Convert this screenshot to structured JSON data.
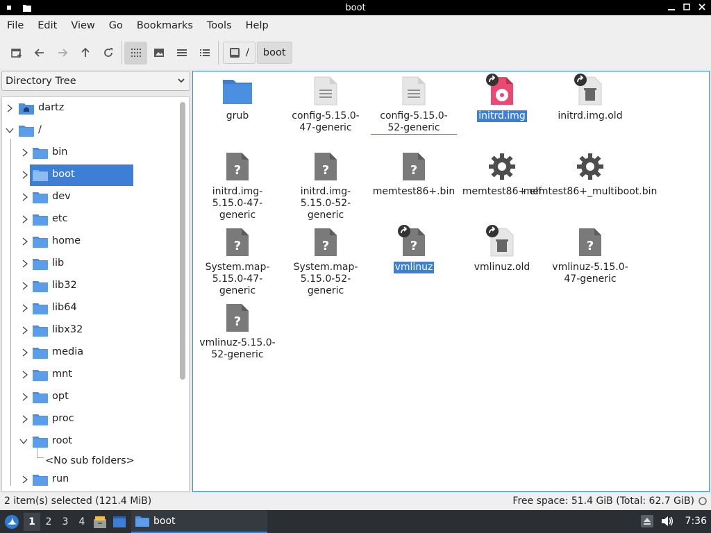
{
  "window": {
    "title": "boot"
  },
  "menu": [
    "File",
    "Edit",
    "View",
    "Go",
    "Bookmarks",
    "Tools",
    "Help"
  ],
  "toolbar": {
    "buttons": [
      "new-tab-icon",
      "back-icon",
      "forward-icon",
      "up-icon",
      "reload-icon",
      "icon-view-icon",
      "thumbnail-view-icon",
      "compact-view-icon",
      "detailed-list-icon"
    ],
    "active_view": "icon-view"
  },
  "path": {
    "root_label": "/",
    "current": "boot"
  },
  "sidebar": {
    "selector_label": "Directory Tree",
    "tree": [
      {
        "label": "dartz",
        "level": 0,
        "expanded": false,
        "icon": "home-folder"
      },
      {
        "label": "/",
        "level": 0,
        "expanded": true,
        "icon": "folder"
      },
      {
        "label": "bin",
        "level": 1,
        "expanded": false
      },
      {
        "label": "boot",
        "level": 1,
        "expanded": false,
        "selected": true
      },
      {
        "label": "dev",
        "level": 1,
        "expanded": false
      },
      {
        "label": "etc",
        "level": 1,
        "expanded": false
      },
      {
        "label": "home",
        "level": 1,
        "expanded": false
      },
      {
        "label": "lib",
        "level": 1,
        "expanded": false
      },
      {
        "label": "lib32",
        "level": 1,
        "expanded": false
      },
      {
        "label": "lib64",
        "level": 1,
        "expanded": false
      },
      {
        "label": "libx32",
        "level": 1,
        "expanded": false
      },
      {
        "label": "media",
        "level": 1,
        "expanded": false
      },
      {
        "label": "mnt",
        "level": 1,
        "expanded": false
      },
      {
        "label": "opt",
        "level": 1,
        "expanded": false
      },
      {
        "label": "proc",
        "level": 1,
        "expanded": false
      },
      {
        "label": "root",
        "level": 1,
        "expanded": true
      },
      {
        "label": "<No sub folders>",
        "level": 2,
        "placeholder": true
      },
      {
        "label": "run",
        "level": 1,
        "expanded": false
      }
    ]
  },
  "files": [
    {
      "name": "grub",
      "type": "folder"
    },
    {
      "name": "config-5.15.0-47-generic",
      "type": "text"
    },
    {
      "name": "config-5.15.0-52-generic",
      "type": "text",
      "focused": true
    },
    {
      "name": "initrd.img",
      "type": "disc",
      "link": true,
      "selected": true
    },
    {
      "name": "initrd.img.old",
      "type": "trash",
      "link": true
    },
    {
      "name": "initrd.img-5.15.0-47-generic",
      "type": "unknown"
    },
    {
      "name": "initrd.img-5.15.0-52-generic",
      "type": "unknown"
    },
    {
      "name": "memtest86+.bin",
      "type": "unknown"
    },
    {
      "name": "memtest86+.elf",
      "type": "executable"
    },
    {
      "name": "memtest86+_multiboot.bin",
      "type": "executable"
    },
    {
      "name": "System.map-5.15.0-47-generic",
      "type": "unknown"
    },
    {
      "name": "System.map-5.15.0-52-generic",
      "type": "unknown"
    },
    {
      "name": "vmlinuz",
      "type": "unknown",
      "link": true,
      "selected": true
    },
    {
      "name": "vmlinuz.old",
      "type": "trash",
      "link": true
    },
    {
      "name": "vmlinuz-5.15.0-47-generic",
      "type": "unknown"
    },
    {
      "name": "vmlinuz-5.15.0-52-generic",
      "type": "unknown"
    }
  ],
  "status": {
    "selection": "2 item(s) selected (121.4 MiB)",
    "free_space": "Free space: 51.4 GiB (Total: 62.7 GiB)"
  },
  "panel": {
    "workspaces": [
      "1",
      "2",
      "3",
      "4"
    ],
    "active_workspace": "1",
    "task_label": "boot",
    "clock": "7:36"
  },
  "colors": {
    "selection": "#3d7fd6",
    "folder": "#4a8fe0",
    "panel": "#2b2e33"
  }
}
